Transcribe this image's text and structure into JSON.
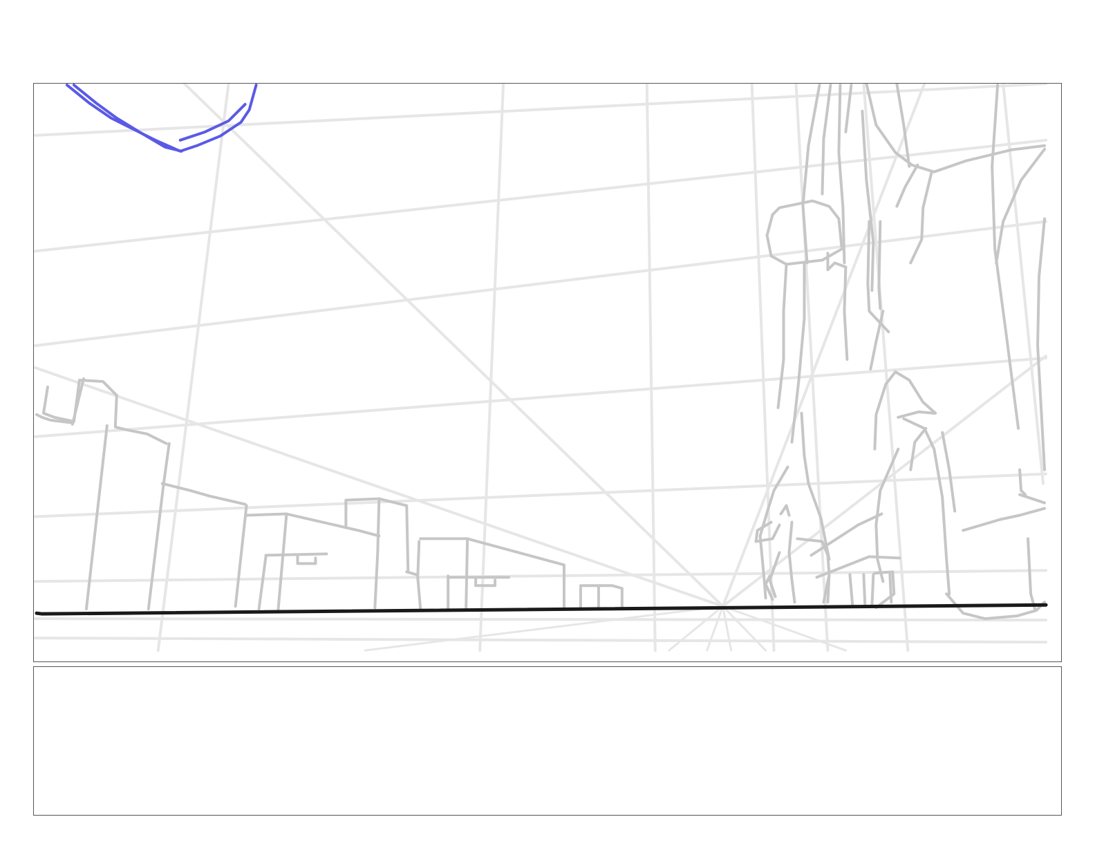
{
  "sheet": {
    "panels": [
      {
        "id": "scene-panel",
        "content": "sketch"
      },
      {
        "id": "notes-panel",
        "notes_text": ""
      }
    ]
  },
  "colors": {
    "perspective_grid": "#e6e6e6",
    "structure_sketch": "#c6c6c6",
    "horizon_line": "#1a1a1a",
    "accent_stroke": "#5a5ae6",
    "panel_border": "#555555",
    "background": "#ffffff"
  },
  "icons": [
    "perspective-grid",
    "horizon-line",
    "building-sketch",
    "figure-sketch",
    "blue-curve-stroke"
  ]
}
